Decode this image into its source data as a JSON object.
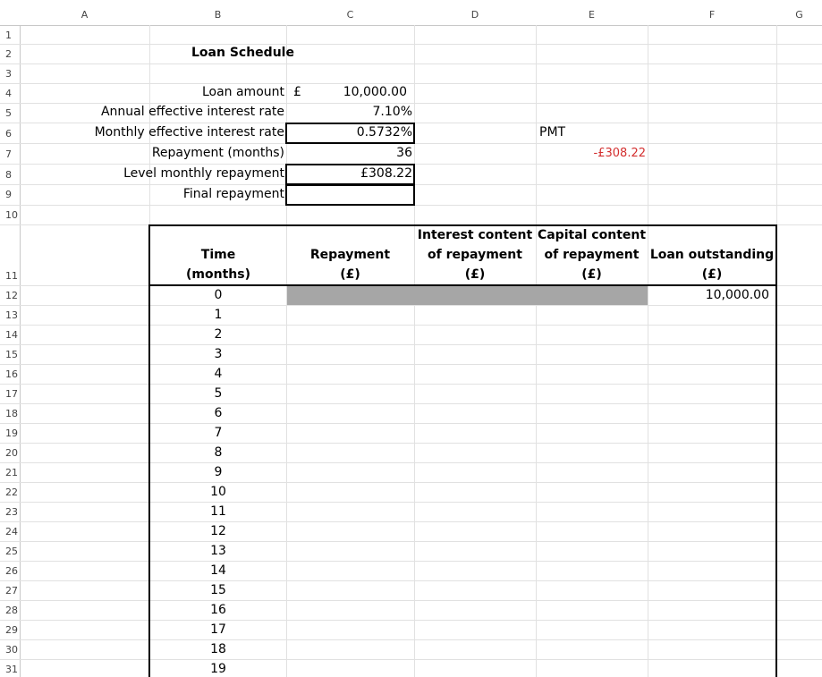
{
  "columns": [
    "A",
    "B",
    "C",
    "D",
    "E",
    "F",
    "G"
  ],
  "rows": [
    "1",
    "2",
    "3",
    "4",
    "5",
    "6",
    "7",
    "8",
    "9",
    "10",
    "11",
    "12",
    "13",
    "14",
    "15",
    "16",
    "17",
    "18",
    "19",
    "20",
    "21",
    "22",
    "23",
    "24",
    "25",
    "26",
    "27",
    "28",
    "29",
    "30",
    "31"
  ],
  "title": "Loan Schedule",
  "inputs": {
    "loan_amount_label": "Loan amount",
    "loan_amount_currency": "£",
    "loan_amount_value": "10,000.00",
    "annual_rate_label": "Annual effective interest rate",
    "annual_rate_value": "7.10%",
    "monthly_rate_label": "Monthly effective interest rate",
    "monthly_rate_value": "0.5732%",
    "repayment_months_label": "Repayment (months)",
    "repayment_months_value": "36",
    "level_repayment_label": "Level monthly repayment",
    "level_repayment_value": "£308.22",
    "final_repayment_label": "Final repayment",
    "final_repayment_value": ""
  },
  "side": {
    "pmt_label": "PMT",
    "pmt_value": "-£308.22",
    "pmt_color": "#d32f2f"
  },
  "table": {
    "headers": {
      "time": [
        "Time",
        "(months)"
      ],
      "repayment": [
        "Repayment",
        "(£)"
      ],
      "interest": [
        "Interest content",
        "of repayment",
        "(£)"
      ],
      "capital": [
        "Capital content",
        "of repayment",
        "(£)"
      ],
      "outstanding": [
        "Loan outstanding",
        "(£)"
      ]
    },
    "initial_outstanding": "10,000.00",
    "times": [
      "0",
      "1",
      "2",
      "3",
      "4",
      "5",
      "6",
      "7",
      "8",
      "9",
      "10",
      "11",
      "12",
      "13",
      "14",
      "15",
      "16",
      "17",
      "18",
      "19"
    ]
  }
}
